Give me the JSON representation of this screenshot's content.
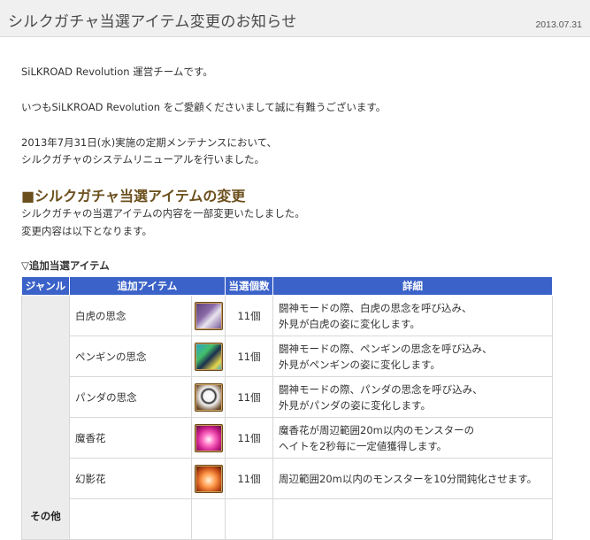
{
  "header": {
    "title": "シルクガチャ当選アイテム変更のお知らせ",
    "date": "2013.07.31"
  },
  "body": {
    "greeting": "SiLKROAD Revolution 運営チームです。",
    "thanks": "いつもSiLKROAD Revolution をご愛顧くださいまして誠に有難うございます。",
    "maint_line1": "2013年7月31日(水)実施の定期メンテナンスにおいて、",
    "maint_line2": "シルクガチャのシステムリニューアルを行いました。"
  },
  "section": {
    "heading": "■シルクガチャ当選アイテムの変更",
    "line1": "シルクガチャの当選アイテムの内容を一部変更いたしました。",
    "line2": "変更内容は以下となります。"
  },
  "table": {
    "subheading": "▽追加当選アイテム",
    "headers": [
      "ジャンル",
      "追加アイテム",
      "当選個数",
      "詳細"
    ],
    "genre": "その他",
    "rows": [
      {
        "name": "白虎の思念",
        "icon": "white-tiger-icon",
        "count": "11個",
        "detail1": "闘神モードの際、白虎の思念を呼び込み、",
        "detail2": "外見が白虎の姿に変化します。"
      },
      {
        "name": "ペンギンの思念",
        "icon": "penguin-icon",
        "count": "11個",
        "detail1": "闘神モードの際、ペンギンの思念を呼び込み、",
        "detail2": "外見がペンギンの姿に変化します。"
      },
      {
        "name": "パンダの思念",
        "icon": "panda-icon",
        "count": "11個",
        "detail1": "闘神モードの際、パンダの思念を呼び込み、",
        "detail2": "外見がパンダの姿に変化します。"
      },
      {
        "name": "魔香花",
        "icon": "magic-flower-icon",
        "count": "11個",
        "detail1": "魔香花が周辺範囲20m以内のモンスターの",
        "detail2": "ヘイトを2秒毎に一定値獲得します。"
      },
      {
        "name": "幻影花",
        "icon": "phantom-flower-icon",
        "count": "11個",
        "detail1": "周辺範囲20m以内のモンスターを10分間鈍化させます。",
        "detail2": ""
      }
    ]
  },
  "colors": {
    "header_blue": "#3a62c8",
    "heading_brown": "#6b4f1d",
    "title_bar": "#f0f0f0"
  }
}
